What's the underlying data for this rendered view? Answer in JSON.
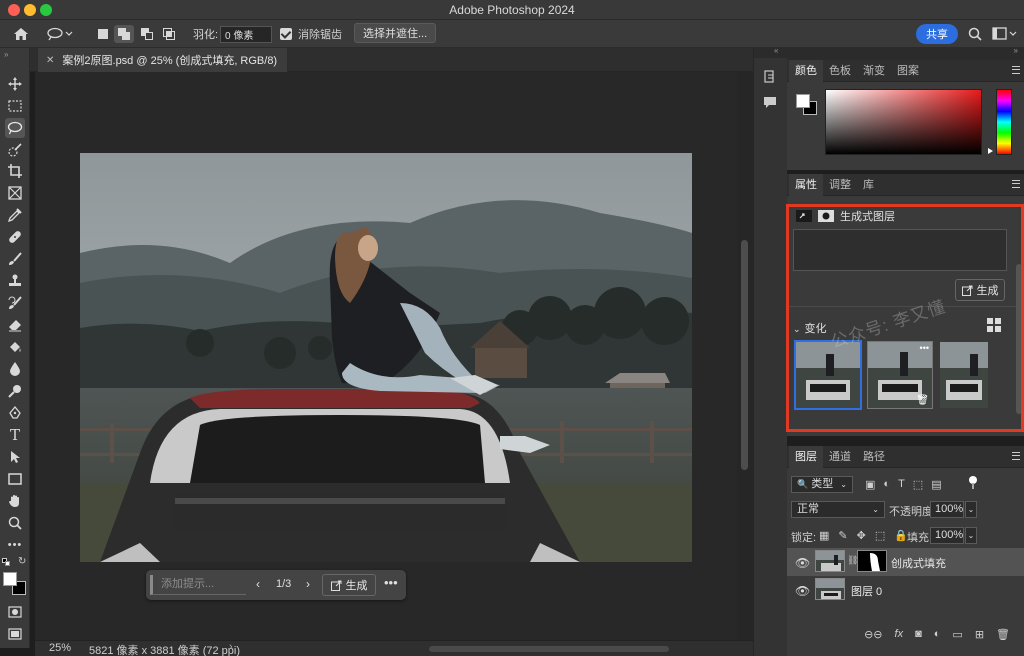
{
  "app": {
    "title": "Adobe Photoshop 2024"
  },
  "options_bar": {
    "feather_label": "羽化:",
    "feather_value": "0 像素",
    "antialias_label": "消除锯齿",
    "select_mask_label": "选择并遮住...",
    "share_label": "共享"
  },
  "document": {
    "tab_title": "案例2原图.psd @ 25% (创成式填充, RGB/8)",
    "zoom": "25%",
    "dimensions": "5821 像素 x 3881 像素 (72 ppi)"
  },
  "context_bar": {
    "prompt_placeholder": "添加提示...",
    "variation_counter": "1/3",
    "generate_label": "生成"
  },
  "color_panel": {
    "tabs": [
      "颜色",
      "色板",
      "渐变",
      "图案"
    ],
    "foreground": "#ffffff",
    "background": "#000000",
    "hue": "#e81a1a"
  },
  "properties_panel": {
    "tabs": [
      "属性",
      "调整",
      "库"
    ],
    "layer_type": "生成式图层",
    "generate_label": "生成",
    "variations_label": "变化"
  },
  "layers_panel": {
    "tabs": [
      "图层",
      "通道",
      "路径"
    ],
    "filter_label": "类型",
    "blend_mode": "正常",
    "opacity_label": "不透明度:",
    "opacity_value": "100%",
    "lock_label": "锁定:",
    "fill_label": "填充:",
    "fill_value": "100%",
    "layers": [
      {
        "name": "创成式填充"
      },
      {
        "name": "图层 0"
      }
    ]
  },
  "watermark": "公众号: 李又懂",
  "colors": {
    "accent": "#2c6ddf",
    "highlight_frame": "#e23a22",
    "panel_bg": "#3a3a3a"
  }
}
